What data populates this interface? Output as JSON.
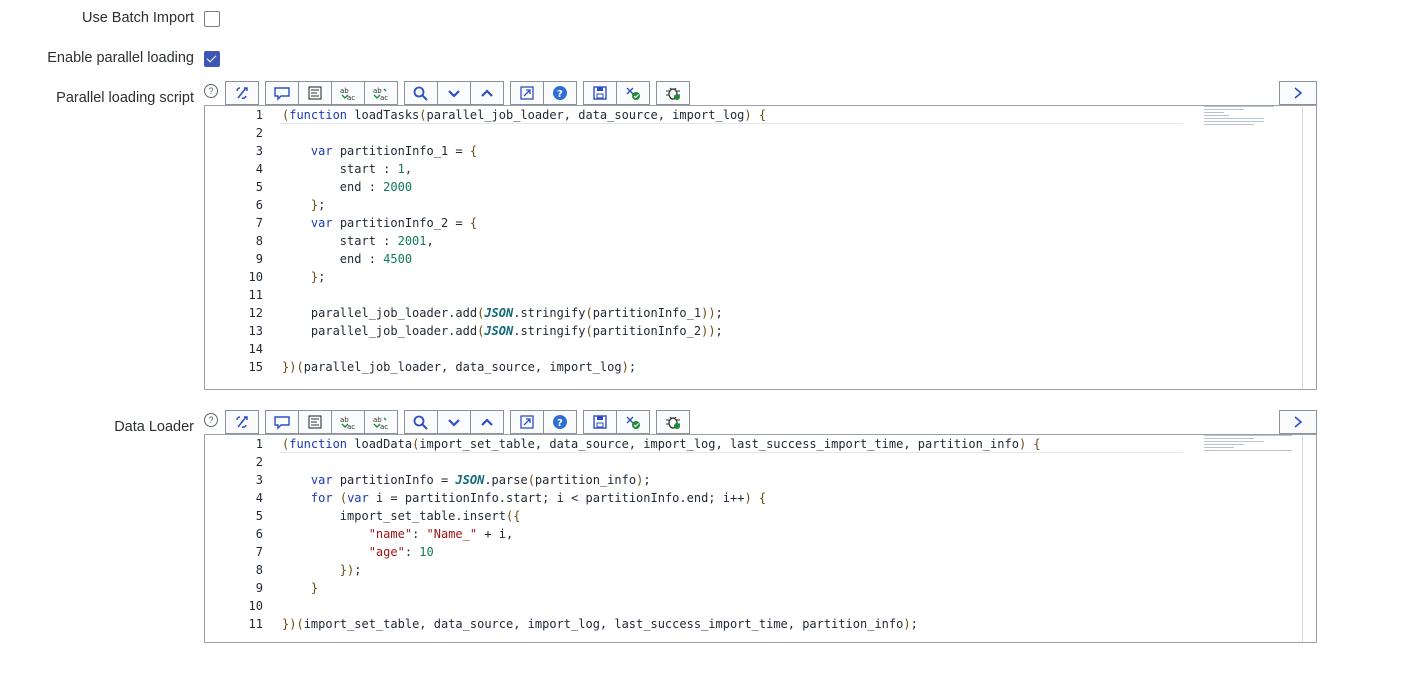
{
  "form": {
    "batch_import": {
      "label": "Use Batch Import",
      "checked": false
    },
    "parallel_loading": {
      "label": "Enable parallel loading",
      "checked": true
    },
    "parallel_script": {
      "label": "Parallel loading script",
      "lines": [
        "(function loadTasks(parallel_job_loader, data_source, import_log) {",
        "",
        "    var partitionInfo_1 = {",
        "        start : 1,",
        "        end : 2000",
        "    };",
        "    var partitionInfo_2 = {",
        "        start : 2001,",
        "        end : 4500",
        "    };",
        "",
        "    parallel_job_loader.add(JSON.stringify(partitionInfo_1));",
        "    parallel_job_loader.add(JSON.stringify(partitionInfo_2));",
        "",
        "})(parallel_job_loader, data_source, import_log);"
      ]
    },
    "data_loader": {
      "label": "Data Loader",
      "lines": [
        "(function loadData(import_set_table, data_source, import_log, last_success_import_time, partition_info) {",
        "",
        "    var partitionInfo = JSON.parse(partition_info);",
        "    for (var i = partitionInfo.start; i < partitionInfo.end; i++) {",
        "        import_set_table.insert({",
        "            \"name\": \"Name_\" + i,",
        "            \"age\": 10",
        "        });",
        "    }",
        "",
        "})(import_set_table, data_source, import_log, last_success_import_time, partition_info);"
      ]
    }
  },
  "help_glyph": "?",
  "toolbar_icons": [
    "script-include-icon",
    "comment-icon",
    "format-icon",
    "replace-icon",
    "replace-all-icon",
    "search-icon",
    "next-icon",
    "previous-icon",
    "fullscreen-icon",
    "help-icon",
    "save-icon",
    "syntax-check-icon",
    "debug-icon"
  ],
  "colors": {
    "accent": "#3f56b7",
    "keyword": "#1b39b5",
    "number": "#117a55",
    "string": "#a31515",
    "json": "#0f6b78"
  }
}
